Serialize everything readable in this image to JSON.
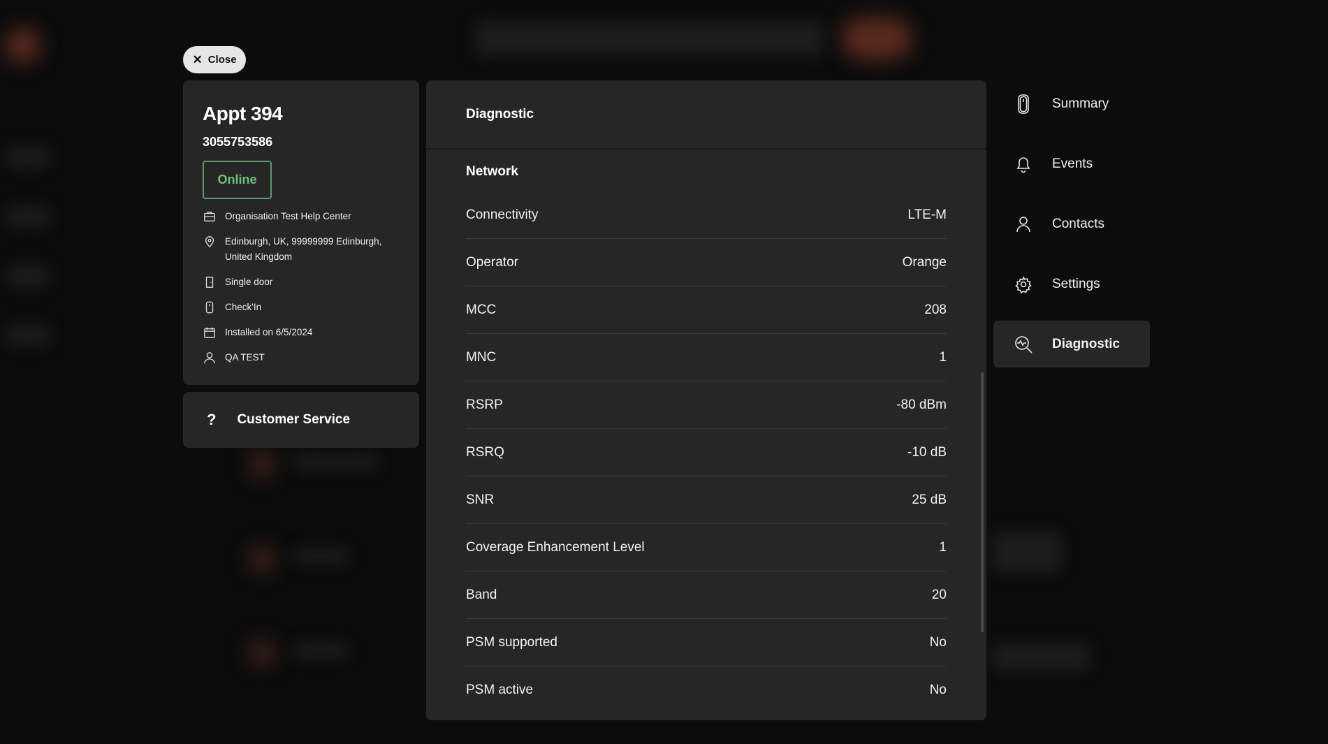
{
  "close_label": "Close",
  "device": {
    "name": "Appt 394",
    "serial": "3055753586",
    "status": "Online",
    "details": {
      "organisation": "Organisation Test Help Center",
      "address": "Edinburgh, UK, 99999999 Edinburgh, United Kingdom",
      "door_type": "Single door",
      "model": "Check'In",
      "installed": "Installed on 6/5/2024",
      "user": "QA TEST"
    }
  },
  "customer_service": {
    "icon": "?",
    "label": "Customer Service"
  },
  "diagnostic": {
    "title": "Diagnostic",
    "section": "Network",
    "rows": [
      {
        "label": "Connectivity",
        "value": "LTE-M"
      },
      {
        "label": "Operator",
        "value": "Orange"
      },
      {
        "label": "MCC",
        "value": "208"
      },
      {
        "label": "MNC",
        "value": "1"
      },
      {
        "label": "RSRP",
        "value": "-80 dBm"
      },
      {
        "label": "RSRQ",
        "value": "-10 dB"
      },
      {
        "label": "SNR",
        "value": "25 dB"
      },
      {
        "label": "Coverage Enhancement Level",
        "value": "1"
      },
      {
        "label": "Band",
        "value": "20"
      },
      {
        "label": "PSM supported",
        "value": "No"
      },
      {
        "label": "PSM active",
        "value": "No"
      }
    ]
  },
  "nav": [
    {
      "label": "Summary",
      "icon": "device-icon"
    },
    {
      "label": "Events",
      "icon": "bell-icon"
    },
    {
      "label": "Contacts",
      "icon": "person-icon"
    },
    {
      "label": "Settings",
      "icon": "gear-icon"
    },
    {
      "label": "Diagnostic",
      "icon": "diagnostic-icon"
    }
  ],
  "colors": {
    "status_online": "#6fbf80",
    "panel": "#262626",
    "backdrop": "#0c0c0c"
  }
}
